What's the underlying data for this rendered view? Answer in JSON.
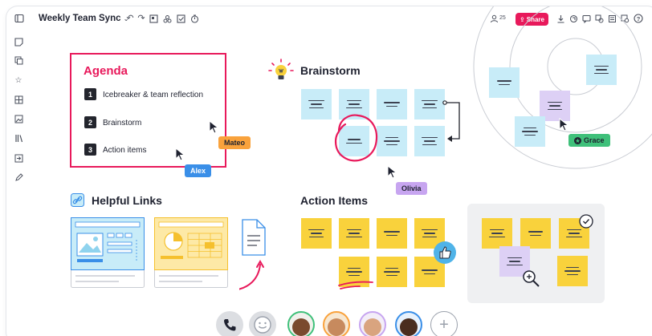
{
  "board": {
    "title": "Weekly Team Sync",
    "users_count": "25",
    "share_label": "Share"
  },
  "agenda": {
    "title": "Agenda",
    "items": [
      {
        "num": "1",
        "text": "Icebreaker & team reflection"
      },
      {
        "num": "2",
        "text": "Brainstorm"
      },
      {
        "num": "3",
        "text": "Action items"
      }
    ]
  },
  "sections": {
    "brainstorm": "Brainstorm",
    "helpful_links": "Helpful Links",
    "action_items": "Action Items"
  },
  "cursors": {
    "mateo": "Mateo",
    "alex": "Alex",
    "olivia": "Olivia",
    "grace": "Grace"
  },
  "colors": {
    "accent": "#e8195b",
    "mateo_tag": "#f9a23c",
    "alex_tag": "#3a8fe8",
    "olivia_tag": "#c7a5f0",
    "grace_tag": "#3fc07a",
    "sticky_blue": "#c8ecf8",
    "sticky_yellow": "#f9d23c",
    "sticky_purple": "#ddd0f5"
  },
  "icons": {
    "top_left": [
      "collapse-panel-icon"
    ],
    "toolbar": [
      "undo-icon",
      "redo-icon",
      "frame-icon",
      "layers-icon",
      "checkbox-icon",
      "timer-icon"
    ],
    "top_right": [
      "users-icon",
      "download-icon",
      "export-icon",
      "comments-icon",
      "chat-icon",
      "copy-icon",
      "grid-icon",
      "search-icon",
      "help-icon"
    ],
    "rail": [
      "sticky-note-icon",
      "cards-icon",
      "star-icon",
      "table-icon",
      "image-icon",
      "library-icon",
      "export-in-icon",
      "pen-icon"
    ],
    "bottom": [
      "phone-icon",
      "emoji-icon",
      "add-icon"
    ]
  }
}
